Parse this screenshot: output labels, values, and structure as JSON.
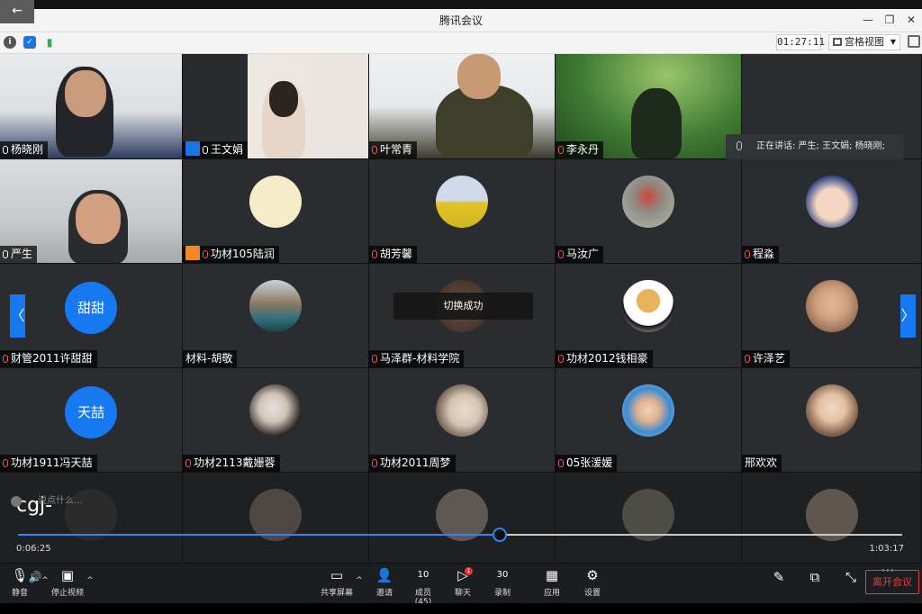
{
  "window": {
    "title": "腾讯会议",
    "back_glyph": "←",
    "minimize": "—",
    "restore": "❐",
    "close": "✕"
  },
  "infobar": {
    "timer": "01:27:11",
    "view_mode": "宫格视图"
  },
  "grid": {
    "tiles": [
      {
        "name": "杨晓刚",
        "kind": "video"
      },
      {
        "name": "王文娟",
        "kind": "video"
      },
      {
        "name": "叶常青",
        "kind": "video"
      },
      {
        "name": "李永丹",
        "kind": "video"
      },
      {
        "name": "",
        "kind": "blank"
      },
      {
        "name": "严生",
        "kind": "video"
      },
      {
        "name": "功材105陆润",
        "kind": "avatar"
      },
      {
        "name": "胡芳馨",
        "kind": "avatar"
      },
      {
        "name": "马汝广",
        "kind": "avatar"
      },
      {
        "name": "程淼",
        "kind": "avatar"
      },
      {
        "name": "财管2011许甜甜",
        "kind": "text",
        "avatar_text": "甜甜"
      },
      {
        "name": "材料-胡敬",
        "kind": "avatar"
      },
      {
        "name": "马泽群-材料学院",
        "kind": "avatar"
      },
      {
        "name": "功材2012钱相豪",
        "kind": "avatar"
      },
      {
        "name": "许泽艺",
        "kind": "avatar"
      },
      {
        "name": "功材1911冯天喆",
        "kind": "text",
        "avatar_text": "天喆"
      },
      {
        "name": "功材2113戴姗蓉",
        "kind": "avatar"
      },
      {
        "name": "功材2011周梦",
        "kind": "avatar"
      },
      {
        "name": "05张湲媛",
        "kind": "avatar"
      },
      {
        "name": "邢欢欢",
        "kind": "avatar"
      }
    ],
    "speaking": "正在讲话: 严生; 王文娟; 杨晓刚;",
    "toast": "切换成功",
    "nav_left": "〈",
    "nav_right": "〉"
  },
  "overlay": {
    "caption": "cgj-",
    "chat_placeholder": "说点什么...",
    "time_current": "0:06:25",
    "time_total": "1:03:17",
    "progress": 0.545
  },
  "toolbar": {
    "mute": "静音",
    "stop_video": "停止视频",
    "share_screen": "共享屏幕",
    "invite": "邀请",
    "members": "成员(45)",
    "members_icon_count": "10",
    "chat": "聊天",
    "chat_badge": "1",
    "record": "录制",
    "record_icon_count": "30",
    "apps": "应用",
    "settings": "设置",
    "leave": "离开会议"
  },
  "colors": {
    "accent": "#1679f2",
    "leave": "#e04040",
    "tile_bg": "#2a2c2f"
  }
}
